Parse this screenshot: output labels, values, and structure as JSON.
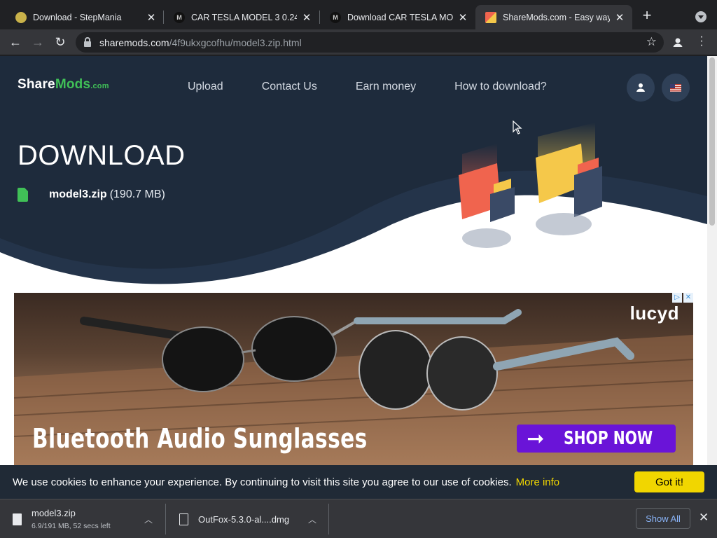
{
  "browser": {
    "tabs": [
      {
        "title": "Download - StepMania",
        "active": false
      },
      {
        "title": "CAR TESLA MODEL 3 0.24 -",
        "active": false
      },
      {
        "title": "Download CAR TESLA MOD",
        "active": false
      },
      {
        "title": "ShareMods.com - Easy way",
        "active": true
      }
    ],
    "url_host": "sharemods.com",
    "url_path": "/4f9ukxgcofhu/model3.zip.html"
  },
  "site": {
    "logo_share": "Share",
    "logo_mods": "Mods",
    "logo_com": ".com",
    "nav": [
      "Upload",
      "Contact Us",
      "Earn money",
      "How to download?"
    ]
  },
  "download": {
    "heading": "DOWNLOAD",
    "file_name": "model3.zip",
    "file_size": "(190.7 MB)"
  },
  "ad": {
    "brand": "lucyd",
    "headline": "Bluetooth Audio Sunglasses",
    "cta": "SHOP NOW",
    "badge_icons": [
      "ad-choices-icon",
      "close-icon"
    ]
  },
  "cookie": {
    "text": "We use cookies to enhance your experience. By continuing to visit this site you agree to our use of cookies.",
    "more_info": "More info",
    "accept": "Got it!"
  },
  "downloads_shelf": {
    "items": [
      {
        "name": "model3.zip",
        "status": "6.9/191 MB, 52 secs left"
      },
      {
        "name": "OutFox-5.3.0-al....dmg",
        "status": ""
      }
    ],
    "show_all": "Show All"
  },
  "colors": {
    "hero_bg": "#1e2b3c",
    "accent_green": "#40c057",
    "cookie_button": "#f1d600",
    "cta_purple": "#6a14d8"
  }
}
